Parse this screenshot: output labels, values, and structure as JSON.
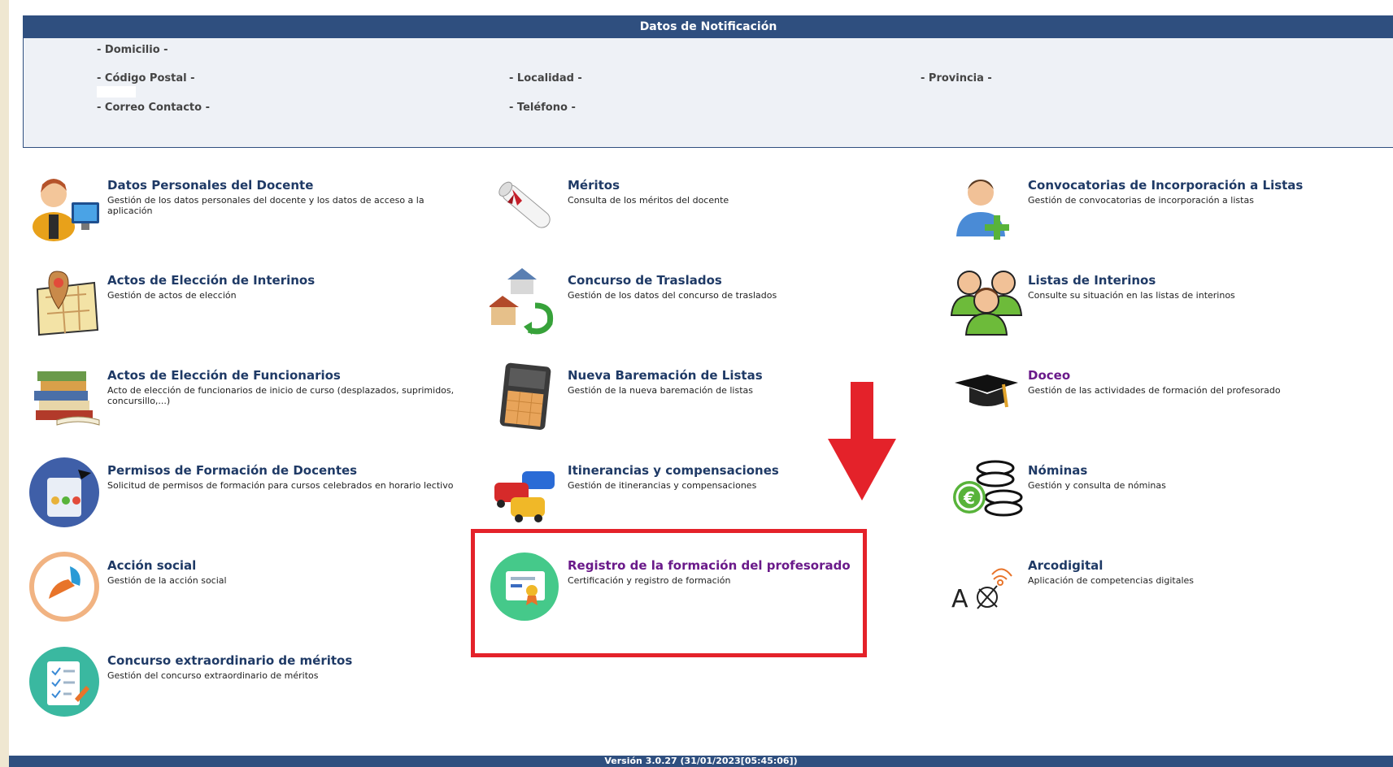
{
  "notification": {
    "header": "Datos de Notificación",
    "domicilio": "- Domicilio -",
    "codigo_postal": "- Código Postal -",
    "localidad": "- Localidad -",
    "provincia": "- Provincia -",
    "correo": "- Correo Contacto -",
    "telefono": "- Teléfono -"
  },
  "modules": [
    {
      "title": "Datos Personales del Docente",
      "desc": "Gestión de los datos personales del docente y los datos de acceso a la aplicación",
      "icon": "teacher-computer-icon"
    },
    {
      "title": "Méritos",
      "desc": "Consulta de los méritos del docente",
      "icon": "diploma-scroll-icon"
    },
    {
      "title": "Convocatorias de Incorporación a Listas",
      "desc": "Gestión de convocatorias de incorporación a listas",
      "icon": "user-add-icon"
    },
    {
      "title": "Actos de Elección de Interinos",
      "desc": "Gestión de actos de elección",
      "icon": "map-pin-icon"
    },
    {
      "title": "Concurso de Traslados",
      "desc": "Gestión de los datos del concurso de traslados",
      "icon": "house-transfer-icon"
    },
    {
      "title": "Listas de Interinos",
      "desc": "Consulte su situación en las listas de interinos",
      "icon": "users-group-icon"
    },
    {
      "title": "Actos de Elección de Funcionarios",
      "desc": "Acto de elección de funcionarios de inicio de curso (desplazados, suprimidos, concursillo,...)",
      "icon": "books-stack-icon"
    },
    {
      "title": "Nueva Baremación de Listas",
      "desc": "Gestión de la nueva baremación de listas",
      "icon": "calculator-icon"
    },
    {
      "title": "Doceo",
      "desc": "Gestión de las actividades de formación del profesorado",
      "icon": "graduation-cap-icon"
    },
    {
      "title": "Permisos de Formación de Docentes",
      "desc": "Solicitud de permisos de formación para cursos celebrados en horario lectivo",
      "icon": "training-tablet-icon"
    },
    {
      "title": "Itinerancias y compensaciones",
      "desc": "Gestión de itinerancias y compensaciones",
      "icon": "cars-icon"
    },
    {
      "title": "Nóminas",
      "desc": "Gestión y consulta de nóminas",
      "icon": "coins-euro-icon"
    },
    {
      "title": "Acción social",
      "desc": "Gestión de la acción social",
      "icon": "helping-hands-icon"
    },
    {
      "title": "Registro de la formación del profesorado",
      "desc": "Certificación y registro de formación",
      "icon": "certificate-icon"
    },
    {
      "title": "Arcodigital",
      "desc": "Aplicación de competencias digitales",
      "icon": "arcodigital-logo-icon"
    },
    {
      "title": "Concurso extraordinario de méritos",
      "desc": "Gestión del concurso extraordinario de méritos",
      "icon": "checklist-icon"
    }
  ],
  "footer": {
    "version": "Versión 3.0.27 (31/01/2023[05:45:06])"
  },
  "colors": {
    "header": "#2f4f7f",
    "highlight": "#e4222a",
    "title": "#1f3a66",
    "visited": "#6a1a8a"
  }
}
